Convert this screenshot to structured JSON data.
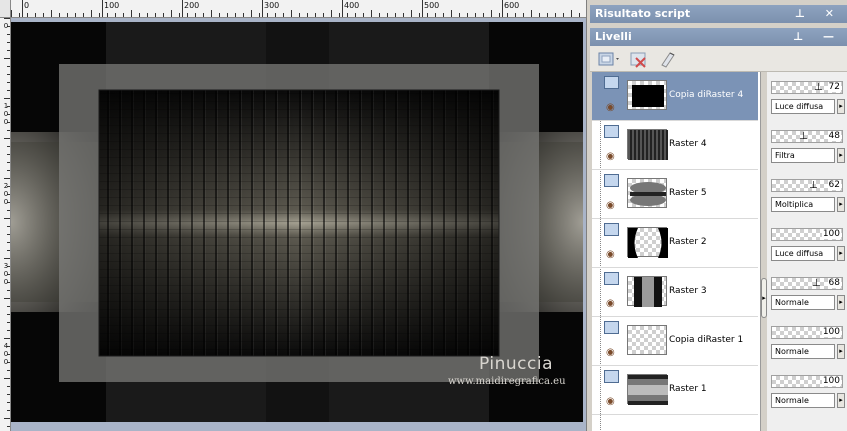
{
  "canvas": {
    "ruler_top_labels": [
      "0",
      "100",
      "200",
      "300",
      "400",
      "500",
      "600"
    ],
    "ruler_left_labels": [
      "0",
      "100",
      "200",
      "300",
      "400"
    ],
    "watermark_title": "Pinuccia",
    "watermark_url": "www.maidiregrafica.eu"
  },
  "panels": {
    "script_output_title": "Risultato script",
    "layers_title": "Livelli",
    "title_buttons": "⊥ ✕",
    "layers_buttons": "⊥ —"
  },
  "layers": [
    {
      "name": "Copia diRaster 4",
      "opacity": "72",
      "blend": "Luce diffusa",
      "selected": true
    },
    {
      "name": "Raster 4",
      "opacity": "48",
      "blend": "Filtra",
      "selected": false
    },
    {
      "name": "Raster 5",
      "opacity": "62",
      "blend": "Moltiplica",
      "selected": false
    },
    {
      "name": "Raster 2",
      "opacity": "100",
      "blend": "Luce diffusa",
      "selected": false
    },
    {
      "name": "Raster 3",
      "opacity": "68",
      "blend": "Normale",
      "selected": false
    },
    {
      "name": "Copia diRaster 1",
      "opacity": "100",
      "blend": "Normale",
      "selected": false
    },
    {
      "name": "Raster 1",
      "opacity": "100",
      "blend": "Normale",
      "selected": false
    }
  ],
  "colors": {
    "panel_title": "#7b90ae",
    "selected_row": "#7b93b6",
    "canvas_bg": "#070707"
  }
}
